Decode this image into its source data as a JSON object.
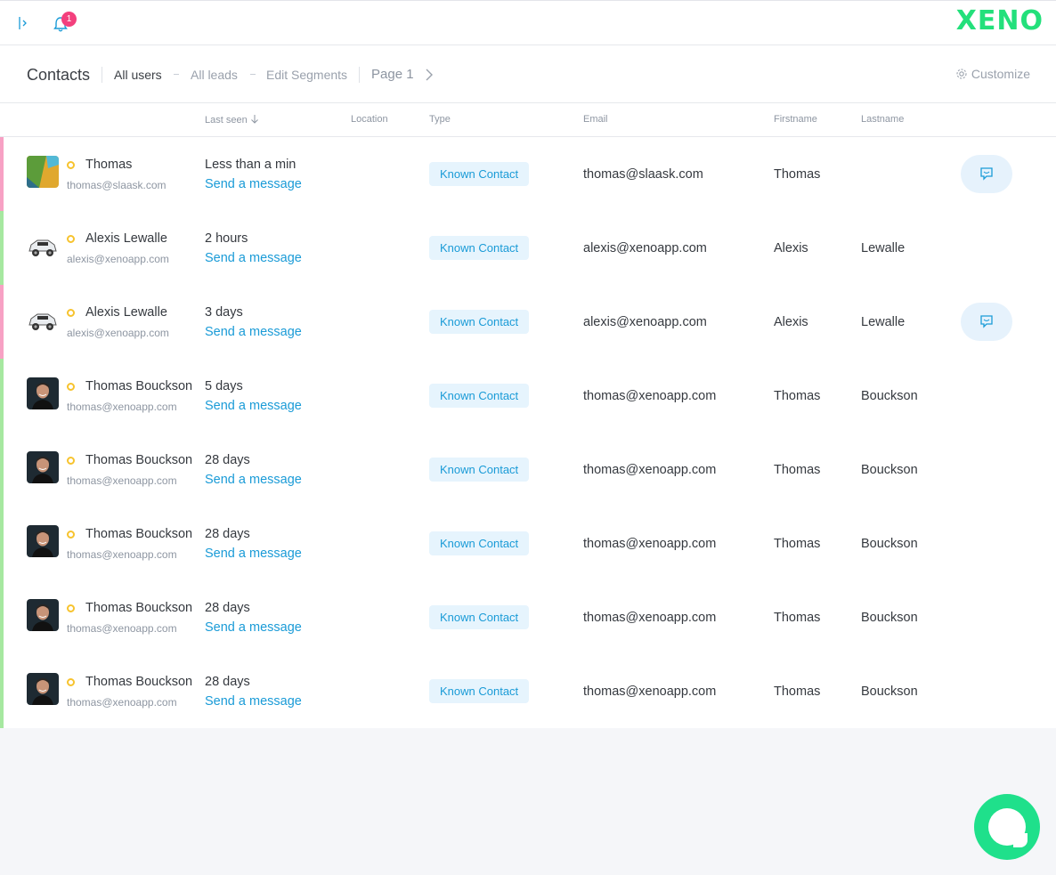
{
  "header": {
    "notification_count": "1",
    "logo_text": "XENO",
    "brand_color": "#23e07b"
  },
  "subheader": {
    "title": "Contacts",
    "tabs": [
      "All users",
      "All leads",
      "Edit Segments"
    ],
    "page": "Page 1",
    "customize": "Customize"
  },
  "table": {
    "columns": {
      "last_seen": "Last seen",
      "location": "Location",
      "type": "Type",
      "email": "Email",
      "firstname": "Firstname",
      "lastname": "Lastname"
    },
    "rows": [
      {
        "name": "Thomas",
        "sub_email": "thomas@slaask.com",
        "last_seen": "Less than a min",
        "action": "Send a message",
        "type": "Known Contact",
        "email": "thomas@slaask.com",
        "firstname": "Thomas",
        "lastname": "",
        "bar": "pink",
        "avatar": "slaask-logo",
        "chat": true
      },
      {
        "name": "Alexis Lewalle",
        "sub_email": "alexis@xenoapp.com",
        "last_seen": "2 hours",
        "action": "Send a message",
        "type": "Known Contact",
        "email": "alexis@xenoapp.com",
        "firstname": "Alexis",
        "lastname": "Lewalle",
        "bar": "green",
        "avatar": "car",
        "chat": false
      },
      {
        "name": "Alexis Lewalle",
        "sub_email": "alexis@xenoapp.com",
        "last_seen": "3 days",
        "action": "Send a message",
        "type": "Known Contact",
        "email": "alexis@xenoapp.com",
        "firstname": "Alexis",
        "lastname": "Lewalle",
        "bar": "pink",
        "avatar": "car",
        "chat": true
      },
      {
        "name": "Thomas Bouckson",
        "sub_email": "thomas@xenoapp.com",
        "last_seen": "5 days",
        "action": "Send a message",
        "type": "Known Contact",
        "email": "thomas@xenoapp.com",
        "firstname": "Thomas",
        "lastname": "Bouckson",
        "bar": "green",
        "avatar": "person",
        "chat": false
      },
      {
        "name": "Thomas Bouckson",
        "sub_email": "thomas@xenoapp.com",
        "last_seen": "28 days",
        "action": "Send a message",
        "type": "Known Contact",
        "email": "thomas@xenoapp.com",
        "firstname": "Thomas",
        "lastname": "Bouckson",
        "bar": "green",
        "avatar": "person",
        "chat": false
      },
      {
        "name": "Thomas Bouckson",
        "sub_email": "thomas@xenoapp.com",
        "last_seen": "28 days",
        "action": "Send a message",
        "type": "Known Contact",
        "email": "thomas@xenoapp.com",
        "firstname": "Thomas",
        "lastname": "Bouckson",
        "bar": "green",
        "avatar": "person",
        "chat": false
      },
      {
        "name": "Thomas Bouckson",
        "sub_email": "thomas@xenoapp.com",
        "last_seen": "28 days",
        "action": "Send a message",
        "type": "Known Contact",
        "email": "thomas@xenoapp.com",
        "firstname": "Thomas",
        "lastname": "Bouckson",
        "bar": "green",
        "avatar": "person",
        "chat": false
      },
      {
        "name": "Thomas Bouckson",
        "sub_email": "thomas@xenoapp.com",
        "last_seen": "28 days",
        "action": "Send a message",
        "type": "Known Contact",
        "email": "thomas@xenoapp.com",
        "firstname": "Thomas",
        "lastname": "Bouckson",
        "bar": "green",
        "avatar": "person",
        "chat": false
      }
    ]
  },
  "colors": {
    "pink_bar": "#f7a1c4",
    "green_bar": "#a6e8a0",
    "link": "#1a9bd7",
    "status_dot": "#f7c32e",
    "launcher": "#1fe08b"
  }
}
